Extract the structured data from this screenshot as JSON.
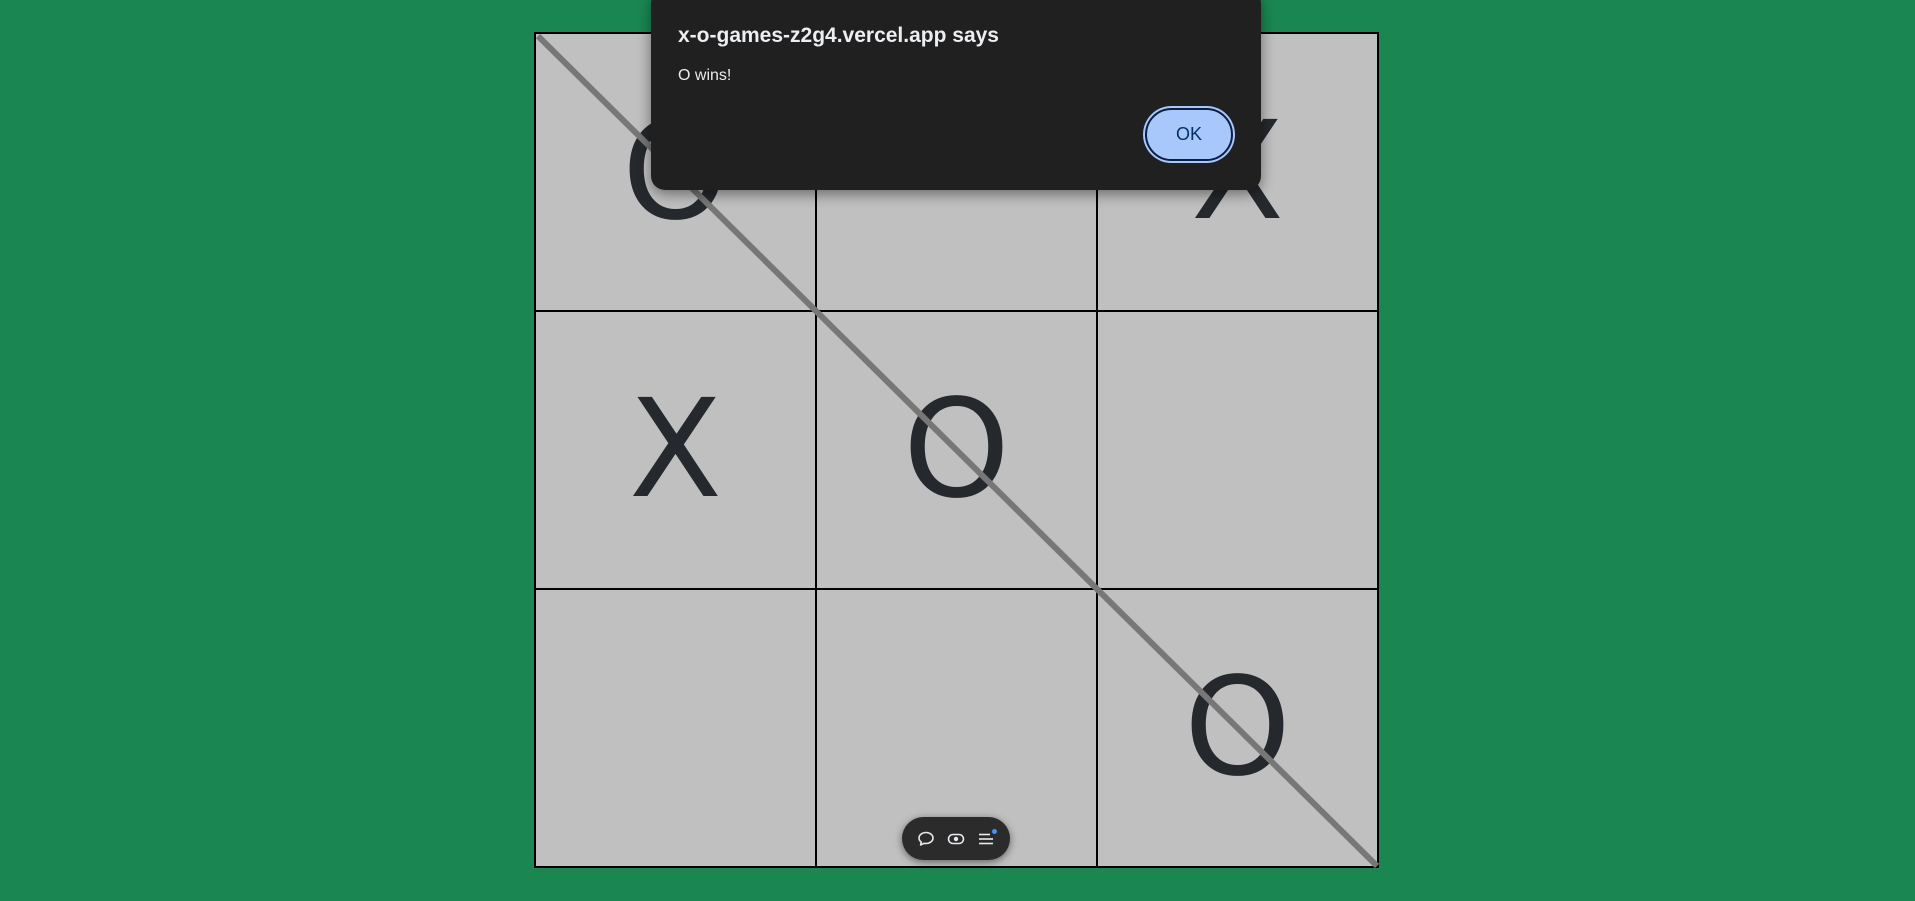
{
  "board": {
    "cells": [
      "O",
      "",
      "X",
      "X",
      "O",
      "",
      "",
      "",
      "O"
    ],
    "winning_line": "diagonal-top-left-to-bottom-right",
    "colors": {
      "background": "#1a8752",
      "cell": "#c0c0c0",
      "mark": "#25282c",
      "strike": "#777777"
    }
  },
  "dialog": {
    "title": "x-o-games-z2g4.vercel.app says",
    "message": "O wins!",
    "ok_label": "OK"
  },
  "toolbar": {
    "icons": [
      "comment-icon",
      "eye-icon",
      "menu-list-icon"
    ]
  }
}
